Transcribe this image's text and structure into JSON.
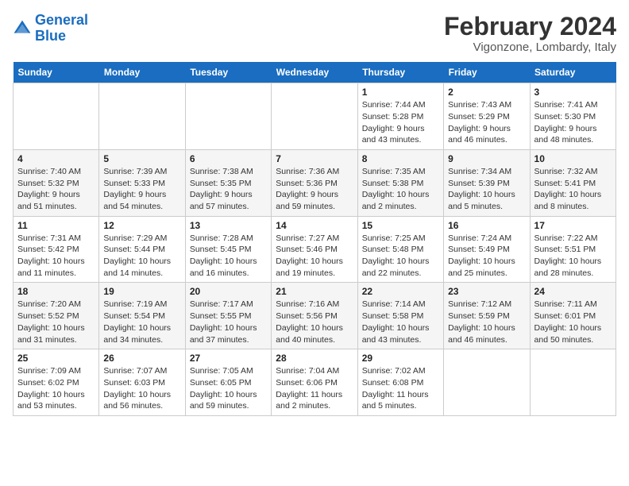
{
  "header": {
    "logo_line1": "General",
    "logo_line2": "Blue",
    "month": "February 2024",
    "location": "Vigonzone, Lombardy, Italy"
  },
  "weekdays": [
    "Sunday",
    "Monday",
    "Tuesday",
    "Wednesday",
    "Thursday",
    "Friday",
    "Saturday"
  ],
  "weeks": [
    [
      {
        "day": "",
        "info": ""
      },
      {
        "day": "",
        "info": ""
      },
      {
        "day": "",
        "info": ""
      },
      {
        "day": "",
        "info": ""
      },
      {
        "day": "1",
        "info": "Sunrise: 7:44 AM\nSunset: 5:28 PM\nDaylight: 9 hours\nand 43 minutes."
      },
      {
        "day": "2",
        "info": "Sunrise: 7:43 AM\nSunset: 5:29 PM\nDaylight: 9 hours\nand 46 minutes."
      },
      {
        "day": "3",
        "info": "Sunrise: 7:41 AM\nSunset: 5:30 PM\nDaylight: 9 hours\nand 48 minutes."
      }
    ],
    [
      {
        "day": "4",
        "info": "Sunrise: 7:40 AM\nSunset: 5:32 PM\nDaylight: 9 hours\nand 51 minutes."
      },
      {
        "day": "5",
        "info": "Sunrise: 7:39 AM\nSunset: 5:33 PM\nDaylight: 9 hours\nand 54 minutes."
      },
      {
        "day": "6",
        "info": "Sunrise: 7:38 AM\nSunset: 5:35 PM\nDaylight: 9 hours\nand 57 minutes."
      },
      {
        "day": "7",
        "info": "Sunrise: 7:36 AM\nSunset: 5:36 PM\nDaylight: 9 hours\nand 59 minutes."
      },
      {
        "day": "8",
        "info": "Sunrise: 7:35 AM\nSunset: 5:38 PM\nDaylight: 10 hours\nand 2 minutes."
      },
      {
        "day": "9",
        "info": "Sunrise: 7:34 AM\nSunset: 5:39 PM\nDaylight: 10 hours\nand 5 minutes."
      },
      {
        "day": "10",
        "info": "Sunrise: 7:32 AM\nSunset: 5:41 PM\nDaylight: 10 hours\nand 8 minutes."
      }
    ],
    [
      {
        "day": "11",
        "info": "Sunrise: 7:31 AM\nSunset: 5:42 PM\nDaylight: 10 hours\nand 11 minutes."
      },
      {
        "day": "12",
        "info": "Sunrise: 7:29 AM\nSunset: 5:44 PM\nDaylight: 10 hours\nand 14 minutes."
      },
      {
        "day": "13",
        "info": "Sunrise: 7:28 AM\nSunset: 5:45 PM\nDaylight: 10 hours\nand 16 minutes."
      },
      {
        "day": "14",
        "info": "Sunrise: 7:27 AM\nSunset: 5:46 PM\nDaylight: 10 hours\nand 19 minutes."
      },
      {
        "day": "15",
        "info": "Sunrise: 7:25 AM\nSunset: 5:48 PM\nDaylight: 10 hours\nand 22 minutes."
      },
      {
        "day": "16",
        "info": "Sunrise: 7:24 AM\nSunset: 5:49 PM\nDaylight: 10 hours\nand 25 minutes."
      },
      {
        "day": "17",
        "info": "Sunrise: 7:22 AM\nSunset: 5:51 PM\nDaylight: 10 hours\nand 28 minutes."
      }
    ],
    [
      {
        "day": "18",
        "info": "Sunrise: 7:20 AM\nSunset: 5:52 PM\nDaylight: 10 hours\nand 31 minutes."
      },
      {
        "day": "19",
        "info": "Sunrise: 7:19 AM\nSunset: 5:54 PM\nDaylight: 10 hours\nand 34 minutes."
      },
      {
        "day": "20",
        "info": "Sunrise: 7:17 AM\nSunset: 5:55 PM\nDaylight: 10 hours\nand 37 minutes."
      },
      {
        "day": "21",
        "info": "Sunrise: 7:16 AM\nSunset: 5:56 PM\nDaylight: 10 hours\nand 40 minutes."
      },
      {
        "day": "22",
        "info": "Sunrise: 7:14 AM\nSunset: 5:58 PM\nDaylight: 10 hours\nand 43 minutes."
      },
      {
        "day": "23",
        "info": "Sunrise: 7:12 AM\nSunset: 5:59 PM\nDaylight: 10 hours\nand 46 minutes."
      },
      {
        "day": "24",
        "info": "Sunrise: 7:11 AM\nSunset: 6:01 PM\nDaylight: 10 hours\nand 50 minutes."
      }
    ],
    [
      {
        "day": "25",
        "info": "Sunrise: 7:09 AM\nSunset: 6:02 PM\nDaylight: 10 hours\nand 53 minutes."
      },
      {
        "day": "26",
        "info": "Sunrise: 7:07 AM\nSunset: 6:03 PM\nDaylight: 10 hours\nand 56 minutes."
      },
      {
        "day": "27",
        "info": "Sunrise: 7:05 AM\nSunset: 6:05 PM\nDaylight: 10 hours\nand 59 minutes."
      },
      {
        "day": "28",
        "info": "Sunrise: 7:04 AM\nSunset: 6:06 PM\nDaylight: 11 hours\nand 2 minutes."
      },
      {
        "day": "29",
        "info": "Sunrise: 7:02 AM\nSunset: 6:08 PM\nDaylight: 11 hours\nand 5 minutes."
      },
      {
        "day": "",
        "info": ""
      },
      {
        "day": "",
        "info": ""
      }
    ]
  ]
}
